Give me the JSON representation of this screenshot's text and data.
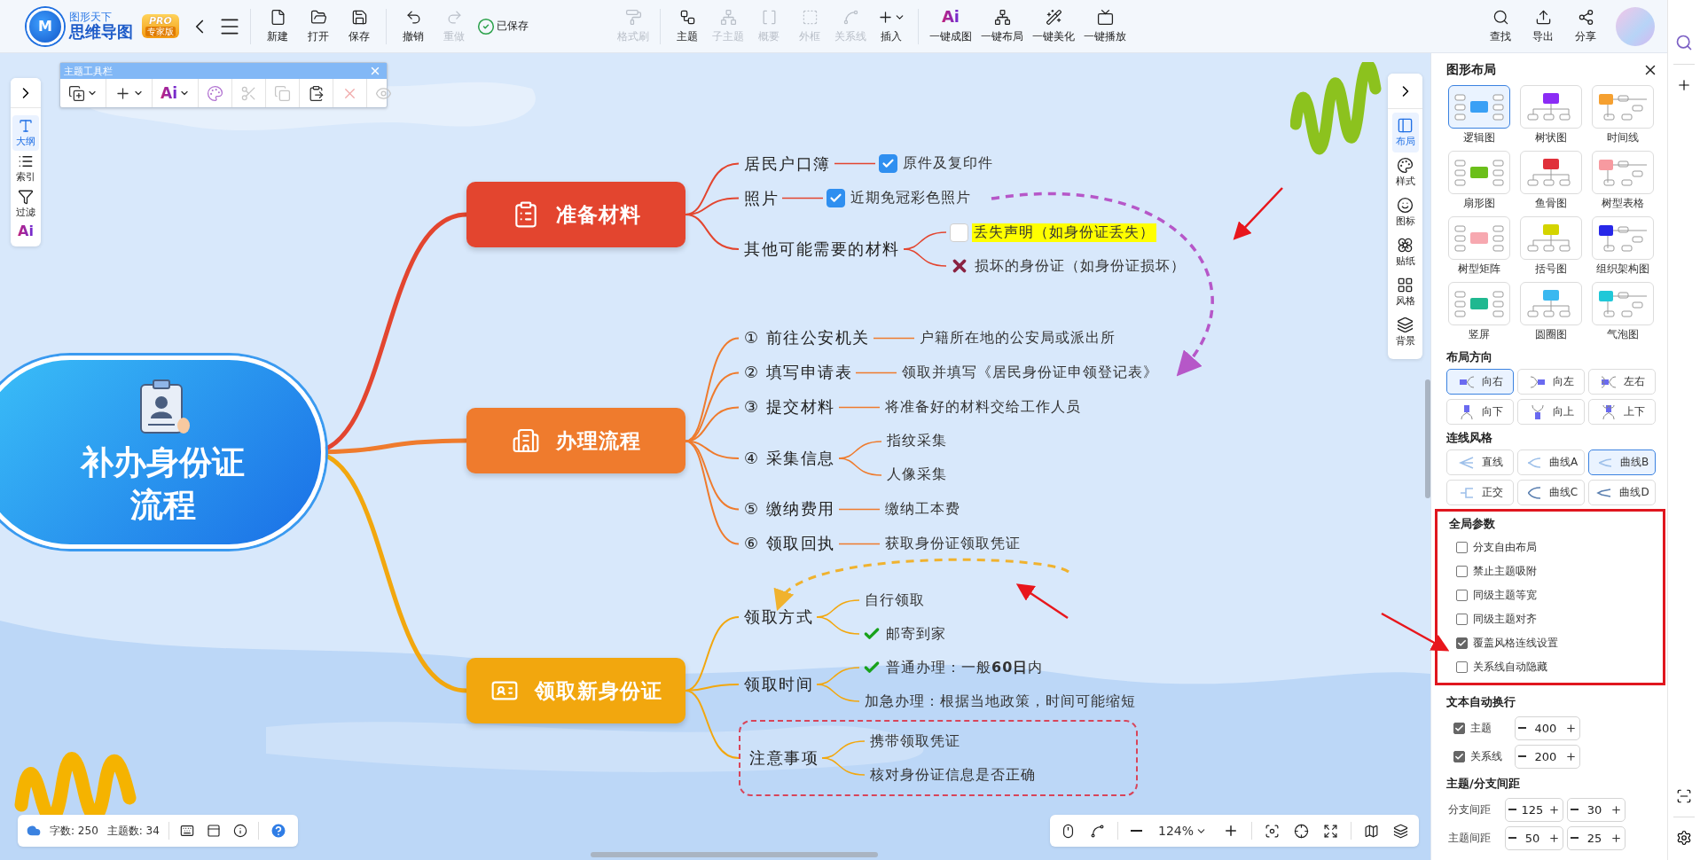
{
  "app": {
    "logo_letter": "M",
    "brand_top": "图形天下",
    "brand_name": "思维导图",
    "badge_top": "PRO",
    "badge_bottom": "专家版"
  },
  "toolbar": {
    "groups": [
      [
        {
          "label": "新建",
          "disabled": false
        },
        {
          "label": "打开",
          "disabled": false
        },
        {
          "label": "保存",
          "disabled": false
        }
      ],
      [
        {
          "label": "撤销",
          "disabled": false
        },
        {
          "label": "重做",
          "disabled": true
        }
      ],
      [
        {
          "label": "格式刷",
          "disabled": true
        }
      ],
      [
        {
          "label": "主题",
          "disabled": false
        },
        {
          "label": "子主题",
          "disabled": true
        },
        {
          "label": "概要",
          "disabled": true
        },
        {
          "label": "外框",
          "disabled": true
        },
        {
          "label": "关系线",
          "disabled": true
        },
        {
          "label": "插入",
          "disabled": false,
          "dropdown": true
        }
      ],
      [
        {
          "label": "一键成图",
          "disabled": false,
          "mark": "Ai"
        },
        {
          "label": "一键布局",
          "disabled": false
        },
        {
          "label": "一键美化",
          "disabled": false
        },
        {
          "label": "一键播放",
          "disabled": false
        }
      ]
    ],
    "saved_status": "已保存",
    "right": [
      {
        "label": "查找"
      },
      {
        "label": "导出"
      },
      {
        "label": "分享"
      }
    ]
  },
  "left_sidebar": {
    "items": [
      {
        "label": "大纲",
        "selected": true
      },
      {
        "label": "索引",
        "selected": false
      },
      {
        "label": "过滤",
        "selected": false
      },
      {
        "mark": "Ai",
        "selected": false
      }
    ]
  },
  "topic_toolbar": {
    "title": "主题工具栏",
    "tools": [
      {
        "disabled": false,
        "dropdown": true
      },
      {
        "disabled": false,
        "dropdown": true
      },
      {
        "mark": "Ai",
        "disabled": false,
        "dropdown": true
      },
      {
        "disabled": false
      },
      {
        "disabled": true
      },
      {
        "disabled": true
      },
      {
        "disabled": false
      },
      {
        "disabled": true
      },
      {
        "disabled": true
      }
    ]
  },
  "canvas_toolbar": {
    "items": [
      {
        "label": "布局",
        "selected": true
      },
      {
        "label": "样式",
        "selected": false
      },
      {
        "label": "图标",
        "selected": false
      },
      {
        "label": "贴纸",
        "selected": false
      },
      {
        "label": "风格",
        "selected": false
      },
      {
        "label": "背景",
        "selected": false
      }
    ]
  },
  "mindmap": {
    "root": "补办身份证流程",
    "branches": [
      {
        "title": "准备材料",
        "color": "#e3452f",
        "children": [
          {
            "label": "居民户口簿",
            "children": [
              {
                "kind": "checkbox",
                "checked": true,
                "highlight": false,
                "text": "原件及复印件"
              }
            ]
          },
          {
            "label": "照片",
            "children": [
              {
                "kind": "checkbox",
                "checked": true,
                "highlight": false,
                "text": "近期免冠彩色照片"
              }
            ]
          },
          {
            "label": "其他可能需要的材料",
            "children": [
              {
                "kind": "checkbox",
                "checked": false,
                "highlight": true,
                "text": "丢失声明（如身份证丢失）"
              },
              {
                "kind": "cross",
                "text": "损坏的身份证（如身份证损坏）"
              }
            ]
          }
        ]
      },
      {
        "title": "办理流程",
        "color": "#ef7b2d",
        "children": [
          {
            "label": "① 前往公安机关",
            "children": [
              {
                "kind": "text",
                "text": "户籍所在地的公安局或派出所"
              }
            ]
          },
          {
            "label": "② 填写申请表",
            "children": [
              {
                "kind": "text",
                "text": "领取并填写《居民身份证申领登记表》"
              }
            ]
          },
          {
            "label": "③ 提交材料",
            "children": [
              {
                "kind": "text",
                "text": "将准备好的材料交给工作人员"
              }
            ]
          },
          {
            "label": "④ 采集信息",
            "children": [
              {
                "kind": "text",
                "text": "指纹采集"
              },
              {
                "kind": "text",
                "text": "人像采集"
              }
            ]
          },
          {
            "label": "⑤ 缴纳费用",
            "children": [
              {
                "kind": "text",
                "text": "缴纳工本费"
              }
            ]
          },
          {
            "label": "⑥ 领取回执",
            "children": [
              {
                "kind": "text",
                "text": "获取身份证领取凭证"
              }
            ]
          }
        ]
      },
      {
        "title": "领取新身份证",
        "color": "#f2a70e",
        "children": [
          {
            "label": "领取方式",
            "framed": false,
            "children": [
              {
                "kind": "text",
                "text": "自行领取"
              },
              {
                "kind": "check",
                "text": "邮寄到家"
              }
            ]
          },
          {
            "label": "领取时间",
            "framed": false,
            "children": [
              {
                "kind": "check",
                "text": "普通办理：一般**60日**内"
              },
              {
                "kind": "text",
                "text": "加急办理：根据当地政策，时间可能缩短"
              }
            ]
          },
          {
            "label": "注意事项",
            "framed": true,
            "children": [
              {
                "kind": "text",
                "text": "携带领取凭证"
              },
              {
                "kind": "text",
                "text": "核对身份证信息是否正确"
              }
            ]
          }
        ]
      }
    ],
    "relations": [
      {
        "color": "#b657c8"
      },
      {
        "color": "#f0b22e"
      }
    ]
  },
  "status": {
    "word_count": "字数: 250",
    "topic_count": "主题数: 34",
    "zoom": "124%"
  },
  "layout_panel": {
    "title": "图形布局",
    "layouts": [
      {
        "label": "逻辑图",
        "selected": true
      },
      {
        "label": "树状图",
        "selected": false
      },
      {
        "label": "时间线",
        "selected": false
      },
      {
        "label": "扇形图",
        "selected": false
      },
      {
        "label": "鱼骨图",
        "selected": false
      },
      {
        "label": "树型表格",
        "selected": false
      },
      {
        "label": "树型矩阵",
        "selected": false
      },
      {
        "label": "括号图",
        "selected": false
      },
      {
        "label": "组织架构图",
        "selected": false
      },
      {
        "label": "竖屏",
        "selected": false
      },
      {
        "label": "圆圈图",
        "selected": false
      },
      {
        "label": "气泡图",
        "selected": false
      }
    ],
    "direction_title": "布局方向",
    "directions": [
      {
        "label": "向右",
        "selected": true
      },
      {
        "label": "向左",
        "selected": false
      },
      {
        "label": "左右",
        "selected": false
      },
      {
        "label": "向下",
        "selected": false
      },
      {
        "label": "向上",
        "selected": false
      },
      {
        "label": "上下",
        "selected": false
      }
    ],
    "line_title": "连线风格",
    "line_styles": [
      {
        "label": "直线",
        "selected": false
      },
      {
        "label": "曲线A",
        "selected": false
      },
      {
        "label": "曲线B",
        "selected": true
      },
      {
        "label": "正交",
        "selected": false
      },
      {
        "label": "曲线C",
        "selected": false
      },
      {
        "label": "曲线D",
        "selected": false
      }
    ],
    "global_title": "全局参数",
    "global_options": [
      {
        "label": "分支自由布局",
        "checked": false
      },
      {
        "label": "禁止主题吸附",
        "checked": false
      },
      {
        "label": "同级主题等宽",
        "checked": false
      },
      {
        "label": "同级主题对齐",
        "checked": false
      },
      {
        "label": "覆盖风格连线设置",
        "checked": true
      },
      {
        "label": "关系线自动隐藏",
        "checked": false
      }
    ],
    "wrap_title": "文本自动换行",
    "wrap_options": [
      {
        "label": "主题",
        "checked": true,
        "value": "400"
      },
      {
        "label": "关系线",
        "checked": true,
        "value": "200"
      }
    ],
    "spacing_title": "主题/分支间距",
    "spacings": [
      {
        "label": "分支间距",
        "values": [
          "125",
          "30"
        ]
      },
      {
        "label": "主题间距",
        "values": [
          "50",
          "25"
        ]
      }
    ]
  }
}
